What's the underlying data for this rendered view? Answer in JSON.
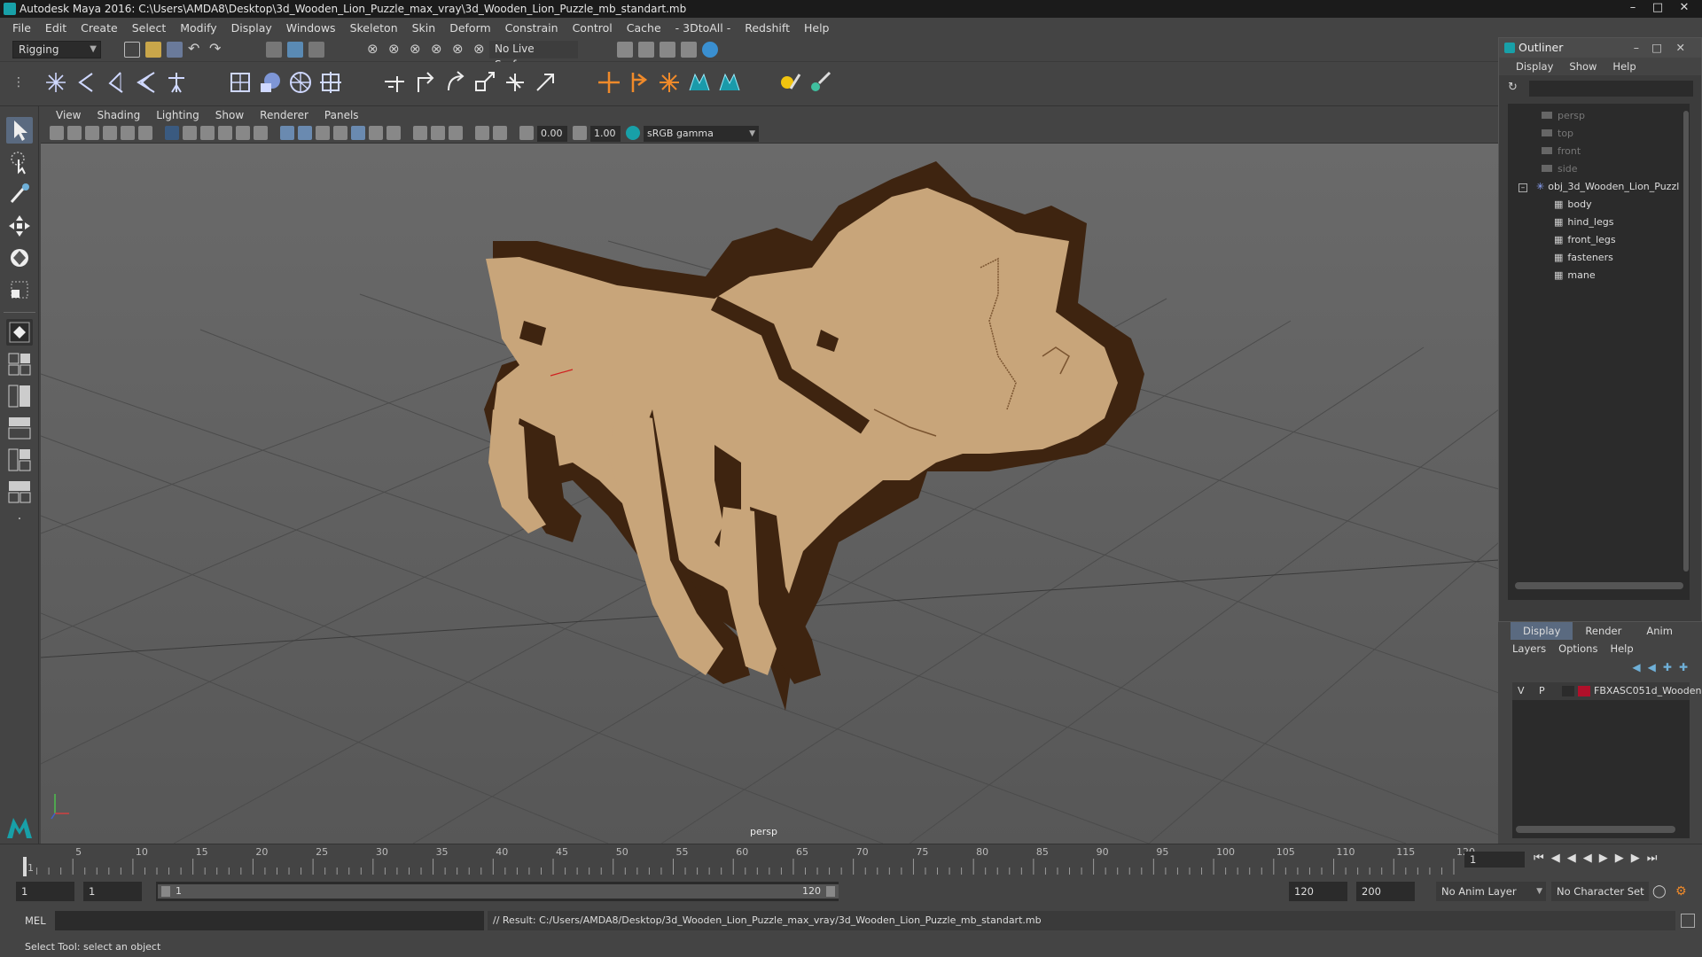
{
  "window": {
    "title": "Autodesk Maya 2016: C:\\Users\\AMDA8\\Desktop\\3d_Wooden_Lion_Puzzle_max_vray\\3d_Wooden_Lion_Puzzle_mb_standart.mb"
  },
  "menubar": [
    "File",
    "Edit",
    "Create",
    "Select",
    "Modify",
    "Display",
    "Windows",
    "Skeleton",
    "Skin",
    "Deform",
    "Constrain",
    "Control",
    "Cache",
    "- 3DtoAll -",
    "Redshift",
    "Help"
  ],
  "toolbar": {
    "mode": "Rigging",
    "live_surface": "No Live Surface"
  },
  "viewport": {
    "menus": [
      "View",
      "Shading",
      "Lighting",
      "Show",
      "Renderer",
      "Panels"
    ],
    "exposure": "0.00",
    "gamma": "1.00",
    "color_space": "sRGB gamma",
    "camera_label": "persp"
  },
  "outliner": {
    "title": "Outliner",
    "menus": [
      "Display",
      "Show",
      "Help"
    ],
    "cameras": [
      "persp",
      "top",
      "front",
      "side"
    ],
    "group": "obj_3d_Wooden_Lion_Puzzl",
    "children": [
      "body",
      "hind_legs",
      "front_legs",
      "fasteners",
      "mane"
    ]
  },
  "layers": {
    "tabs": [
      "Display",
      "Render",
      "Anim"
    ],
    "menus": [
      "Layers",
      "Options",
      "Help"
    ],
    "layer": {
      "v": "V",
      "p": "P",
      "name": "FBXASC051d_Wooden",
      "color": "#b0102a"
    }
  },
  "timeline": {
    "ticks": [
      "1",
      "5",
      "10",
      "15",
      "20",
      "25",
      "30",
      "35",
      "40",
      "45",
      "50",
      "55",
      "60",
      "65",
      "70",
      "75",
      "80",
      "85",
      "90",
      "95",
      "100",
      "105",
      "110",
      "115",
      "120"
    ],
    "current_frame": "1"
  },
  "range": {
    "start": "1",
    "start_inner": "1",
    "slider_start": "1",
    "slider_end": "120",
    "end_inner": "120",
    "end": "200",
    "anim_layer": "No Anim Layer",
    "character_set": "No Character Set"
  },
  "cmdline": {
    "label": "MEL",
    "result": "// Result: C:/Users/AMDA8/Desktop/3d_Wooden_Lion_Puzzle_max_vray/3d_Wooden_Lion_Puzzle_mb_standart.mb"
  },
  "status": {
    "help": "Select Tool: select an object"
  },
  "colors": {
    "wood_light": "#c8a57a",
    "wood_dark": "#3e2410",
    "accent": "#18a0a8"
  }
}
